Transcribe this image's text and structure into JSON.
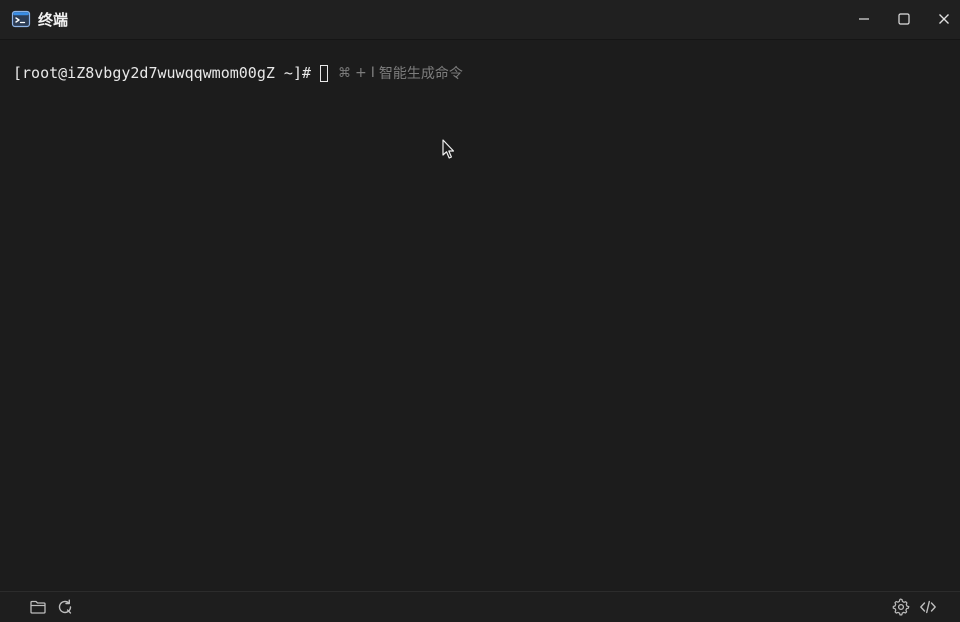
{
  "window": {
    "title": "终端"
  },
  "terminal": {
    "prompt": "[root@iZ8vbgy2d7wuwqqwmom00gZ ~]#",
    "hint": {
      "cmd_symbol": "⌘",
      "plus": "+",
      "key": "I",
      "text": "智能生成命令"
    }
  },
  "colors": {
    "background": "#1c1c1c",
    "titlebar": "#202020",
    "prompt_text": "#e8e8e8",
    "hint_text": "#7d7d7d",
    "icon": "#bdbdbd",
    "app_icon_accent": "#3a8ee6"
  },
  "icons": {
    "app": "terminal-app-icon",
    "minimize": "minimize-icon",
    "maximize": "maximize-icon",
    "close": "close-icon",
    "folder": "folder-icon",
    "refresh": "refresh-icon",
    "settings": "gear-icon",
    "code": "code-icon"
  }
}
